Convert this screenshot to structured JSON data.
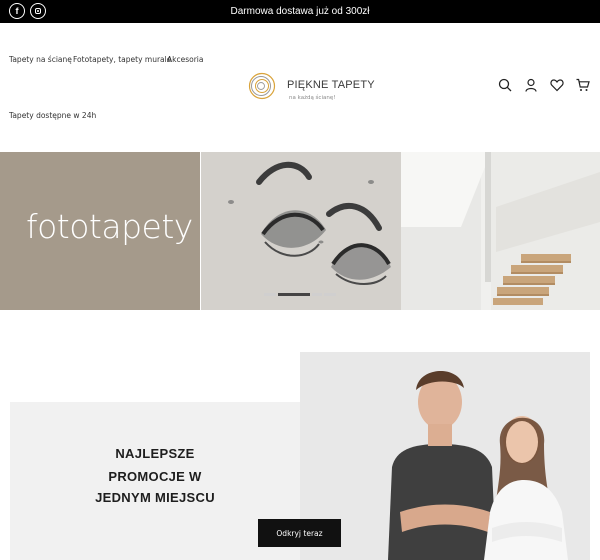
{
  "topbar": {
    "promo_text": "Darmowa dostawa już od 300zł",
    "social": [
      {
        "name": "facebook-icon",
        "glyph": "f"
      },
      {
        "name": "instagram-icon"
      }
    ]
  },
  "nav": {
    "items": [
      {
        "label": "Tapety na ścianę"
      },
      {
        "label": "Fototapety, tapety murale"
      },
      {
        "label": "Akcesoria"
      }
    ],
    "availability": "Tapety dostępne w 24h"
  },
  "logo": {
    "title": "PIĘKNE TAPETY",
    "subtitle": "na każdą ścianę!",
    "colors": {
      "ring_gold": "#d9a33a",
      "ring_grey": "#9a9a9a"
    }
  },
  "header_icons": [
    "search-icon",
    "user-icon",
    "heart-icon",
    "cart-icon"
  ],
  "hero": {
    "title": "fototapety",
    "slide_count": 4,
    "active_slide": 1,
    "colors": {
      "left_panel": "#a59a8b"
    }
  },
  "promo": {
    "lines": [
      "NAJLEPSZE",
      "PROMOCJE W",
      "JEDNYM MIEJSCU"
    ],
    "cta_label": "Odkryj teraz"
  }
}
